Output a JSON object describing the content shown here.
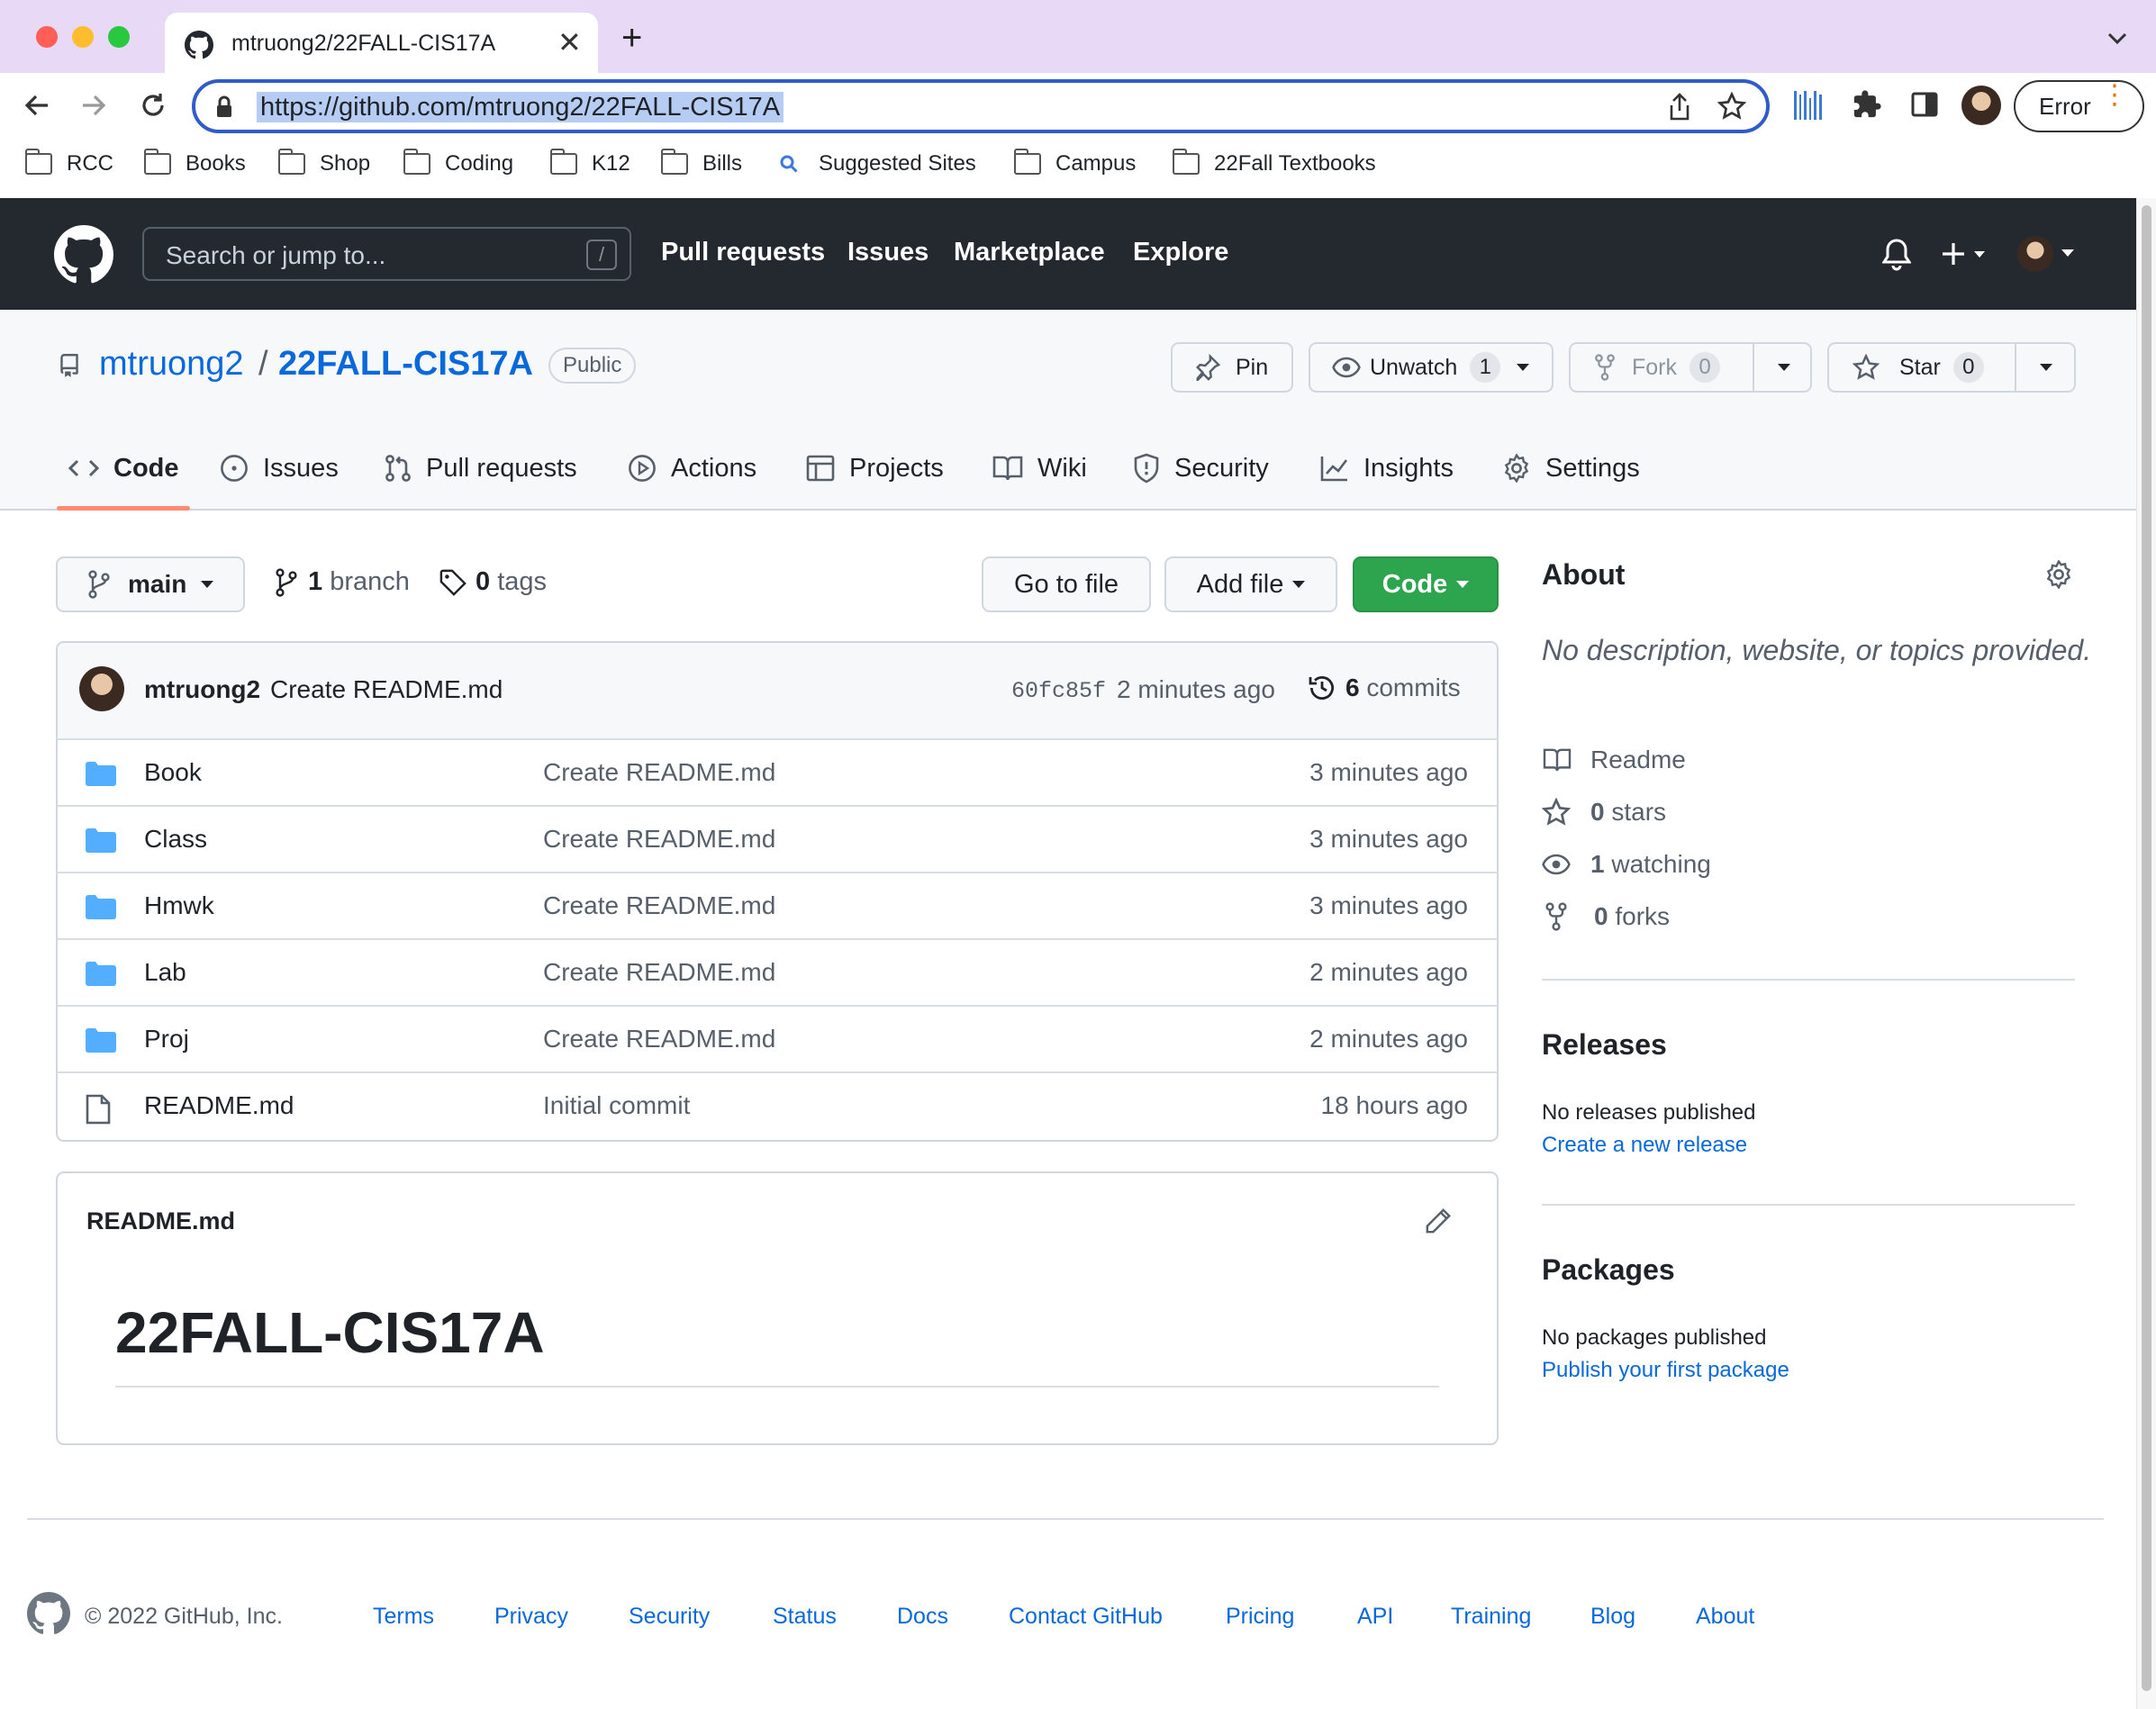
{
  "browser": {
    "tab_title": "mtruong2/22FALL-CIS17A",
    "url": "https://github.com/mtruong2/22FALL-CIS17A",
    "profile_button": "Error",
    "bookmarks": [
      "RCC",
      "Books",
      "Shop",
      "Coding",
      "K12",
      "Bills",
      "Suggested Sites",
      "Campus",
      "22Fall Textbooks"
    ]
  },
  "github_header": {
    "search_placeholder": "Search or jump to...",
    "search_shortcut": "/",
    "nav": [
      "Pull requests",
      "Issues",
      "Marketplace",
      "Explore"
    ]
  },
  "repo": {
    "owner": "mtruong2",
    "separator": "/",
    "name": "22FALL-CIS17A",
    "visibility": "Public",
    "pin_label": "Pin",
    "watch_label": "Unwatch",
    "watch_count": "1",
    "fork_label": "Fork",
    "fork_count": "0",
    "star_label": "Star",
    "star_count": "0"
  },
  "repo_tabs": [
    "Code",
    "Issues",
    "Pull requests",
    "Actions",
    "Projects",
    "Wiki",
    "Security",
    "Insights",
    "Settings"
  ],
  "toolbar": {
    "branch": "main",
    "branch_count": "1",
    "branch_word": "branch",
    "tag_count": "0",
    "tag_word": "tags",
    "go_to_file": "Go to file",
    "add_file": "Add file",
    "code": "Code"
  },
  "latest_commit": {
    "author": "mtruong2",
    "message": "Create README.md",
    "sha": "60fc85f",
    "time": "2 minutes ago",
    "commit_count": "6",
    "commit_word": "commits"
  },
  "files": [
    {
      "name": "Book",
      "message": "Create README.md",
      "age": "3 minutes ago",
      "type": "folder"
    },
    {
      "name": "Class",
      "message": "Create README.md",
      "age": "3 minutes ago",
      "type": "folder"
    },
    {
      "name": "Hmwk",
      "message": "Create README.md",
      "age": "3 minutes ago",
      "type": "folder"
    },
    {
      "name": "Lab",
      "message": "Create README.md",
      "age": "2 minutes ago",
      "type": "folder"
    },
    {
      "name": "Proj",
      "message": "Create README.md",
      "age": "2 minutes ago",
      "type": "folder"
    },
    {
      "name": "README.md",
      "message": "Initial commit",
      "age": "18 hours ago",
      "type": "file"
    }
  ],
  "readme": {
    "filename": "README.md",
    "heading": "22FALL-CIS17A"
  },
  "about": {
    "title": "About",
    "description": "No description, website, or topics provided.",
    "readme": "Readme",
    "stars_count": "0",
    "stars_word": "stars",
    "watching_count": "1",
    "watching_word": "watching",
    "forks_count": "0",
    "forks_word": "forks"
  },
  "releases": {
    "title": "Releases",
    "text": "No releases published",
    "link": "Create a new release"
  },
  "packages": {
    "title": "Packages",
    "text": "No packages published",
    "link": "Publish your first package"
  },
  "footer": {
    "copyright": "© 2022 GitHub, Inc.",
    "links": [
      "Terms",
      "Privacy",
      "Security",
      "Status",
      "Docs",
      "Contact GitHub",
      "Pricing",
      "API",
      "Training",
      "Blog",
      "About"
    ]
  },
  "colors": {
    "tabbar": "#e8d9f7",
    "github_header": "#24292f",
    "code_button": "#2da44e",
    "link": "#0969da",
    "folder": "#54aeff"
  }
}
